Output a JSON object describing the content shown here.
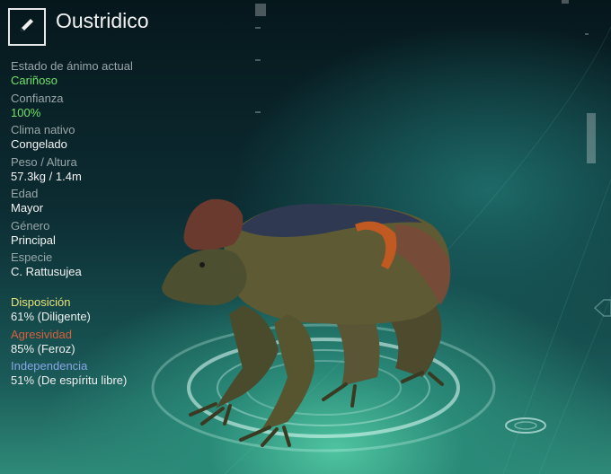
{
  "header": {
    "name": "Oustridico",
    "edit_icon": "pencil-icon"
  },
  "stats": [
    {
      "id": "mood",
      "label": "Estado de ánimo actual",
      "value": "Cariñoso",
      "highlight": true
    },
    {
      "id": "trust",
      "label": "Confianza",
      "value": "100%",
      "highlight": true
    },
    {
      "id": "climate",
      "label": "Clima nativo",
      "value": "Congelado",
      "highlight": false
    },
    {
      "id": "weight-height",
      "label": "Peso / Altura",
      "value": "57.3kg / 1.4m",
      "highlight": false
    },
    {
      "id": "age",
      "label": "Edad",
      "value": "Mayor",
      "highlight": false
    },
    {
      "id": "gender",
      "label": "Género",
      "value": "Principal",
      "highlight": false
    },
    {
      "id": "species",
      "label": "Especie",
      "value": "C. Rattusujea",
      "highlight": false
    }
  ],
  "traits": [
    {
      "id": "disposition",
      "label": "Disposición",
      "value": "61% (Diligente)",
      "color": "#e6e27a"
    },
    {
      "id": "aggression",
      "label": "Agresividad",
      "value": "85% (Feroz)",
      "color": "#d8603c"
    },
    {
      "id": "independence",
      "label": "Independencia",
      "value": "51% (De espíritu libre)",
      "color": "#8aa6e8"
    }
  ],
  "colors": {
    "highlight": "#6ee26a",
    "label": "#9aa6a8"
  }
}
